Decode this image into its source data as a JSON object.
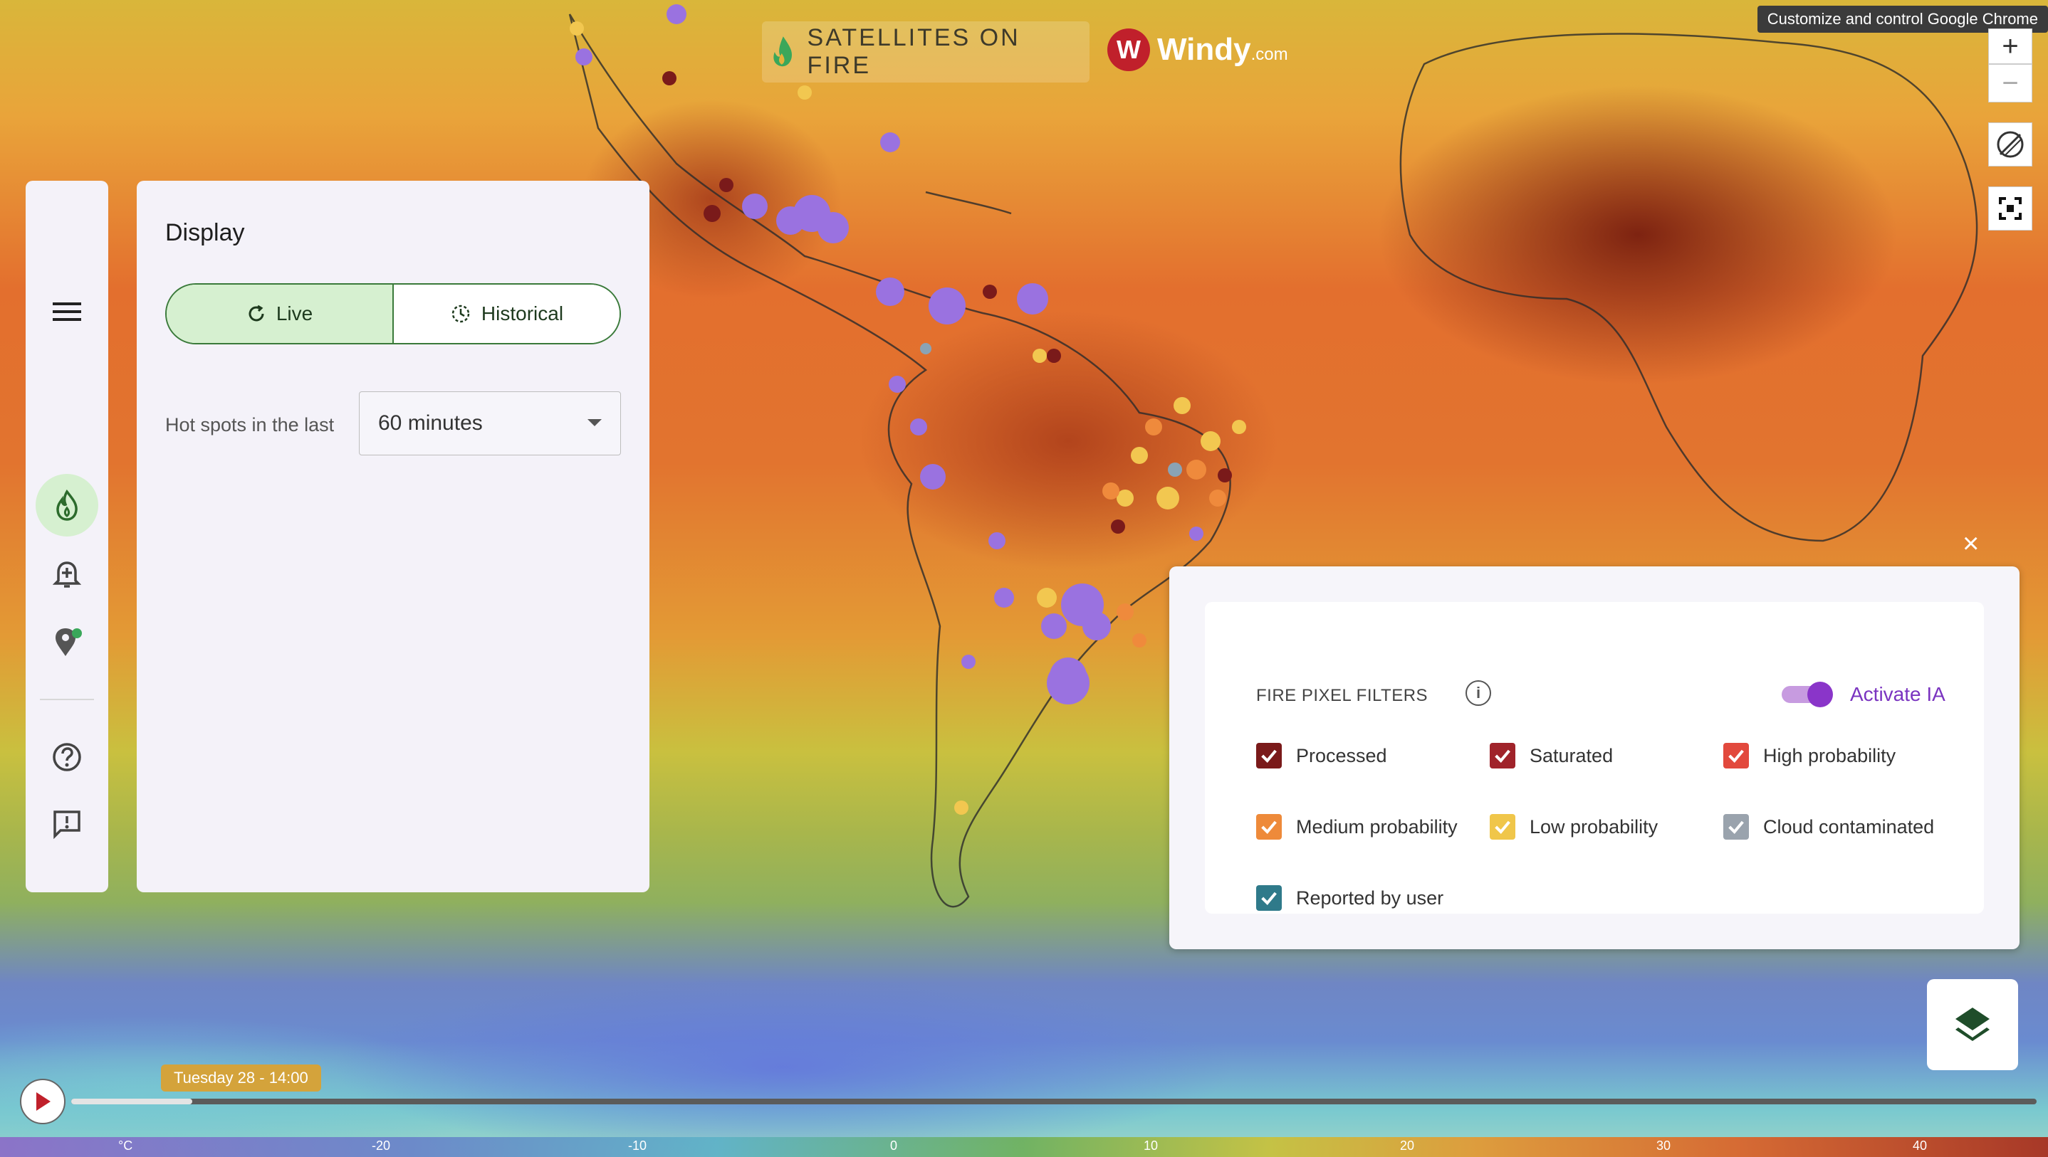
{
  "brand": {
    "title": "SATELLITES ON FIRE",
    "partner": "Windy",
    "partner_suffix": ".com"
  },
  "tooltip": "Customize and control Google Chrome",
  "map_controls": {
    "zoom_in": "+",
    "zoom_out": "−"
  },
  "panel": {
    "title": "Display",
    "modes": [
      {
        "label": "Live",
        "active": true
      },
      {
        "label": "Historical",
        "active": false
      }
    ],
    "hot_spots_label": "Hot spots in the last",
    "hot_spots_value": "60 minutes"
  },
  "filters": {
    "title": "FIRE PIXEL FILTERS",
    "info": "i",
    "ai_toggle_label": "Activate IA",
    "ai_toggle_on": true,
    "items": [
      {
        "label": "Processed",
        "color": "#7a1a1a",
        "checked": true
      },
      {
        "label": "Saturated",
        "color": "#a0232a",
        "checked": true
      },
      {
        "label": "High probability",
        "color": "#e2493d",
        "checked": true
      },
      {
        "label": "Medium probability",
        "color": "#ee8a3a",
        "checked": true
      },
      {
        "label": "Low probability",
        "color": "#f0c64a",
        "checked": true
      },
      {
        "label": "Cloud contaminated",
        "color": "#9aa3ad",
        "checked": true
      },
      {
        "label": "Reported by user",
        "color": "#2f7a8a",
        "checked": true
      }
    ],
    "close": "×"
  },
  "timeline": {
    "current": "Tuesday 28 - 14:00",
    "scale_unit": "°C",
    "scale_ticks": [
      "-20",
      "-10",
      "0",
      "10",
      "20",
      "30",
      "40"
    ]
  }
}
